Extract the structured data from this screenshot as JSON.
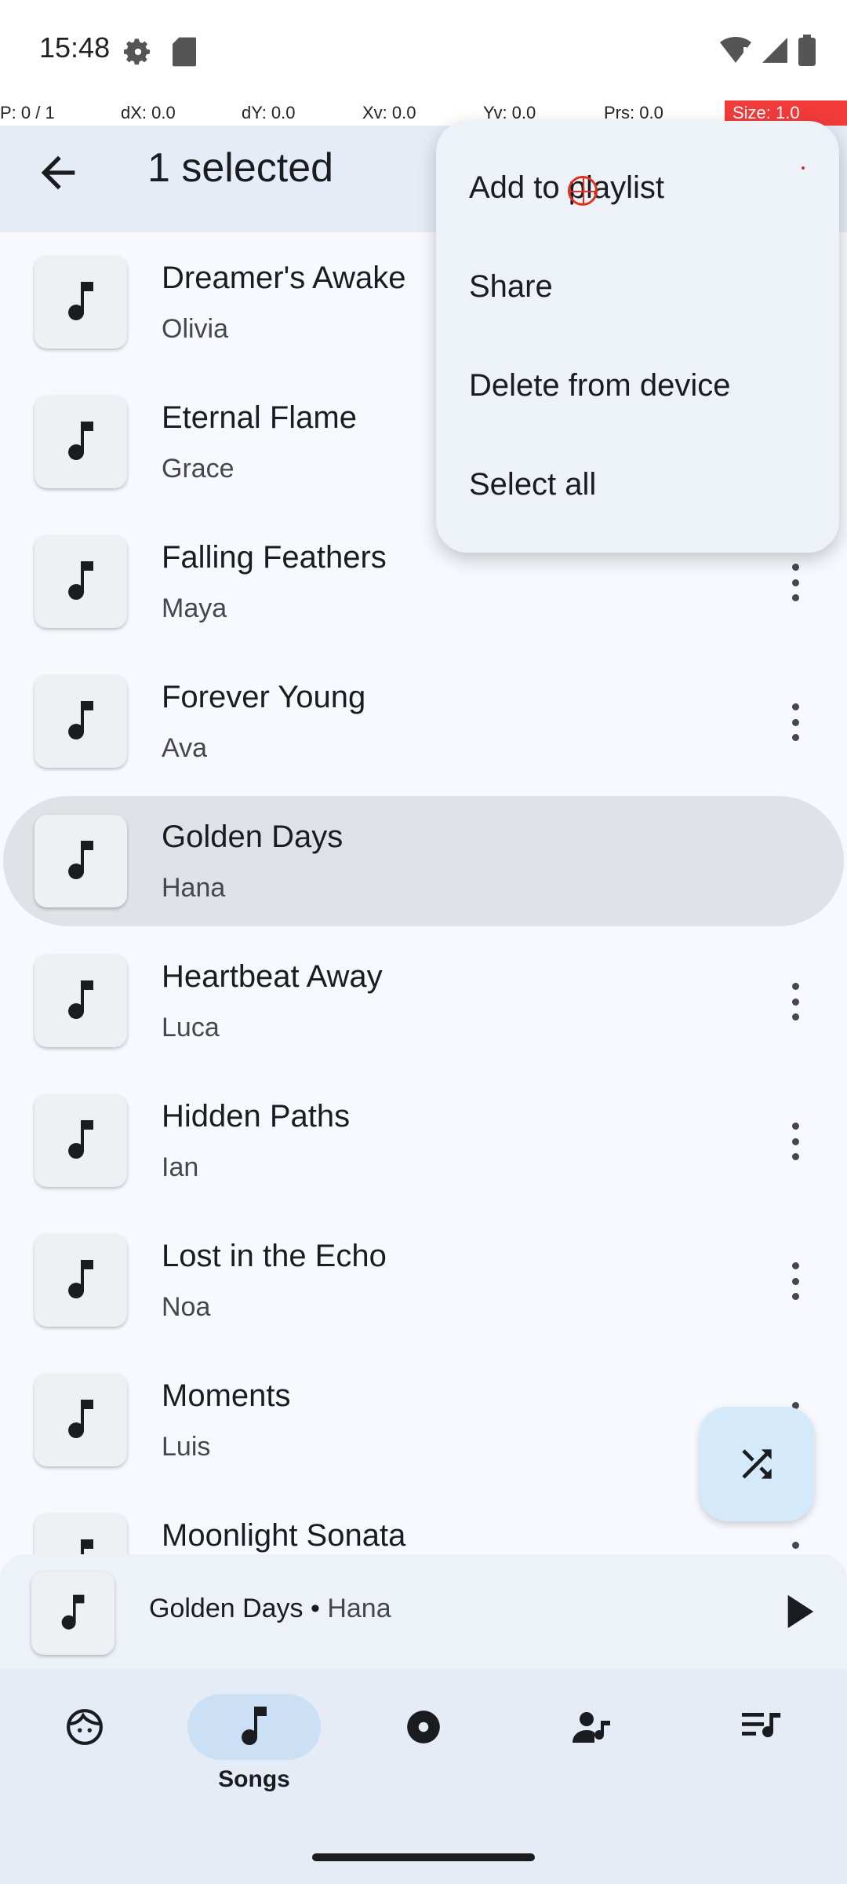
{
  "status_bar": {
    "time": "15:48"
  },
  "debug_bar": {
    "p": "P: 0 / 1",
    "dx": "dX: 0.0",
    "dy": "dY: 0.0",
    "xv": "Xv: 0.0",
    "yv": "Yv: 0.0",
    "prs": "Prs: 0.0",
    "size": "Size: 1.0"
  },
  "app_bar": {
    "title": "1 selected"
  },
  "songs": [
    {
      "title": "Dreamer's Awake",
      "artist": "Olivia"
    },
    {
      "title": "Eternal Flame",
      "artist": "Grace"
    },
    {
      "title": "Falling Feathers",
      "artist": "Maya"
    },
    {
      "title": "Forever Young",
      "artist": "Ava"
    },
    {
      "title": "Golden Days",
      "artist": "Hana"
    },
    {
      "title": "Heartbeat Away",
      "artist": "Luca"
    },
    {
      "title": "Hidden Paths",
      "artist": "Ian"
    },
    {
      "title": "Lost in the Echo",
      "artist": "Noa"
    },
    {
      "title": "Moments",
      "artist": "Luis"
    },
    {
      "title": "Moonlight Sonata",
      "artist": ""
    }
  ],
  "menu": {
    "items": [
      "Add to playlist",
      "Share",
      "Delete from device",
      "Select all"
    ]
  },
  "now_playing": {
    "title": "Golden Days",
    "separator": " • ",
    "artist": "Hana"
  },
  "bottom_nav": {
    "items": [
      "",
      "Songs",
      "",
      "",
      ""
    ],
    "active_label": "Songs"
  },
  "colors": {
    "accent_container": "#CCE0F5",
    "fab": "#D4EAFB",
    "selected_row": "#E0E2E8"
  }
}
